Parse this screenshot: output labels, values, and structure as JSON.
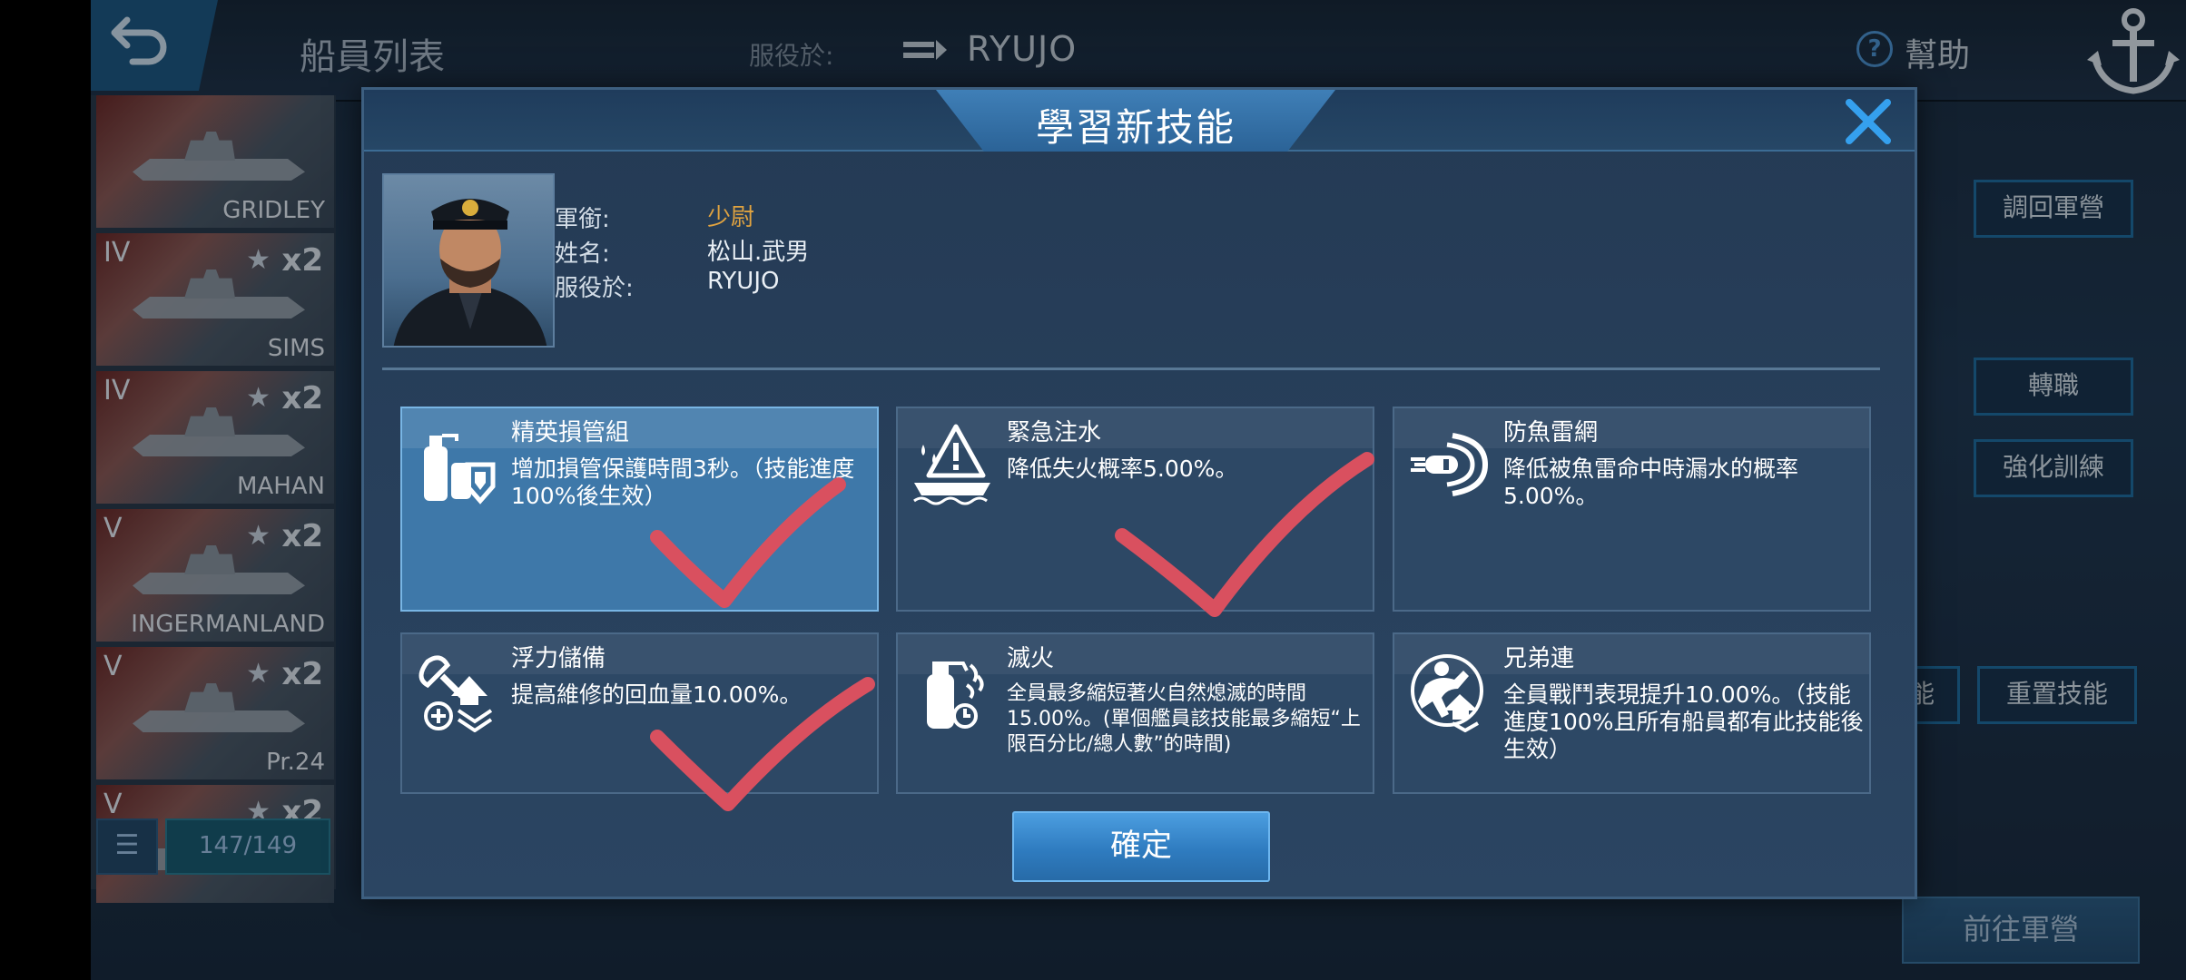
{
  "topbar": {
    "title": "船員列表",
    "serve_label": "服役於:",
    "ship": "RYUJO",
    "help": "幫助"
  },
  "ship_list": [
    {
      "tier": "",
      "name": "GRIDLEY",
      "mult": ""
    },
    {
      "tier": "IV",
      "name": "SIMS",
      "mult": "x2"
    },
    {
      "tier": "IV",
      "name": "MAHAN",
      "mult": "x2"
    },
    {
      "tier": "V",
      "name": "INGERMANLAND",
      "mult": "x2"
    },
    {
      "tier": "V",
      "name": "Pr.24",
      "mult": "x2"
    },
    {
      "tier": "V",
      "name": "",
      "mult": "x2"
    }
  ],
  "list_count": "147/149",
  "right_buttons": {
    "recall": "調回軍營",
    "transfer": "轉職",
    "training": "強化訓練",
    "reset": "重置技能",
    "skill_partial": "能"
  },
  "goto_barracks": "前往軍營",
  "modal": {
    "title": "學習新技能",
    "crew": {
      "rank_label": "軍銜:",
      "rank": "少尉",
      "name_label": "姓名:",
      "name": "松山.武男",
      "serve_label": "服役於:",
      "serve": "RYUJO"
    },
    "skills": [
      {
        "name": "精英損管組",
        "desc": "增加損管保護時間3秒。（技能進度100%後生效）",
        "icon": "damage-control-icon",
        "selected": true
      },
      {
        "name": "緊急注水",
        "desc": "降低失火概率5.00%。",
        "icon": "emergency-flooding-icon",
        "selected": false
      },
      {
        "name": "防魚雷網",
        "desc": "降低被魚雷命中時漏水的概率5.00%。",
        "icon": "torpedo-net-icon",
        "selected": false
      },
      {
        "name": "浮力儲備",
        "desc": "提高維修的回血量10.00%。",
        "icon": "buoyancy-reserve-icon",
        "selected": false
      },
      {
        "name": "滅火",
        "desc": "全員最多縮短著火自然熄滅的時間15.00%。(單個艦員該技能最多縮短“上限百分比/總人數”的時間)",
        "icon": "fire-extinguish-icon",
        "selected": false
      },
      {
        "name": "兄弟連",
        "desc": "全員戰鬥表現提升10.00%。（技能進度100%且所有船員都有此技能後生效）",
        "icon": "brotherhood-icon",
        "selected": false
      }
    ],
    "confirm": "確定"
  },
  "colors": {
    "accent": "#3e78a9",
    "rank": "#e0a340",
    "check_mark": "#d9505f"
  }
}
